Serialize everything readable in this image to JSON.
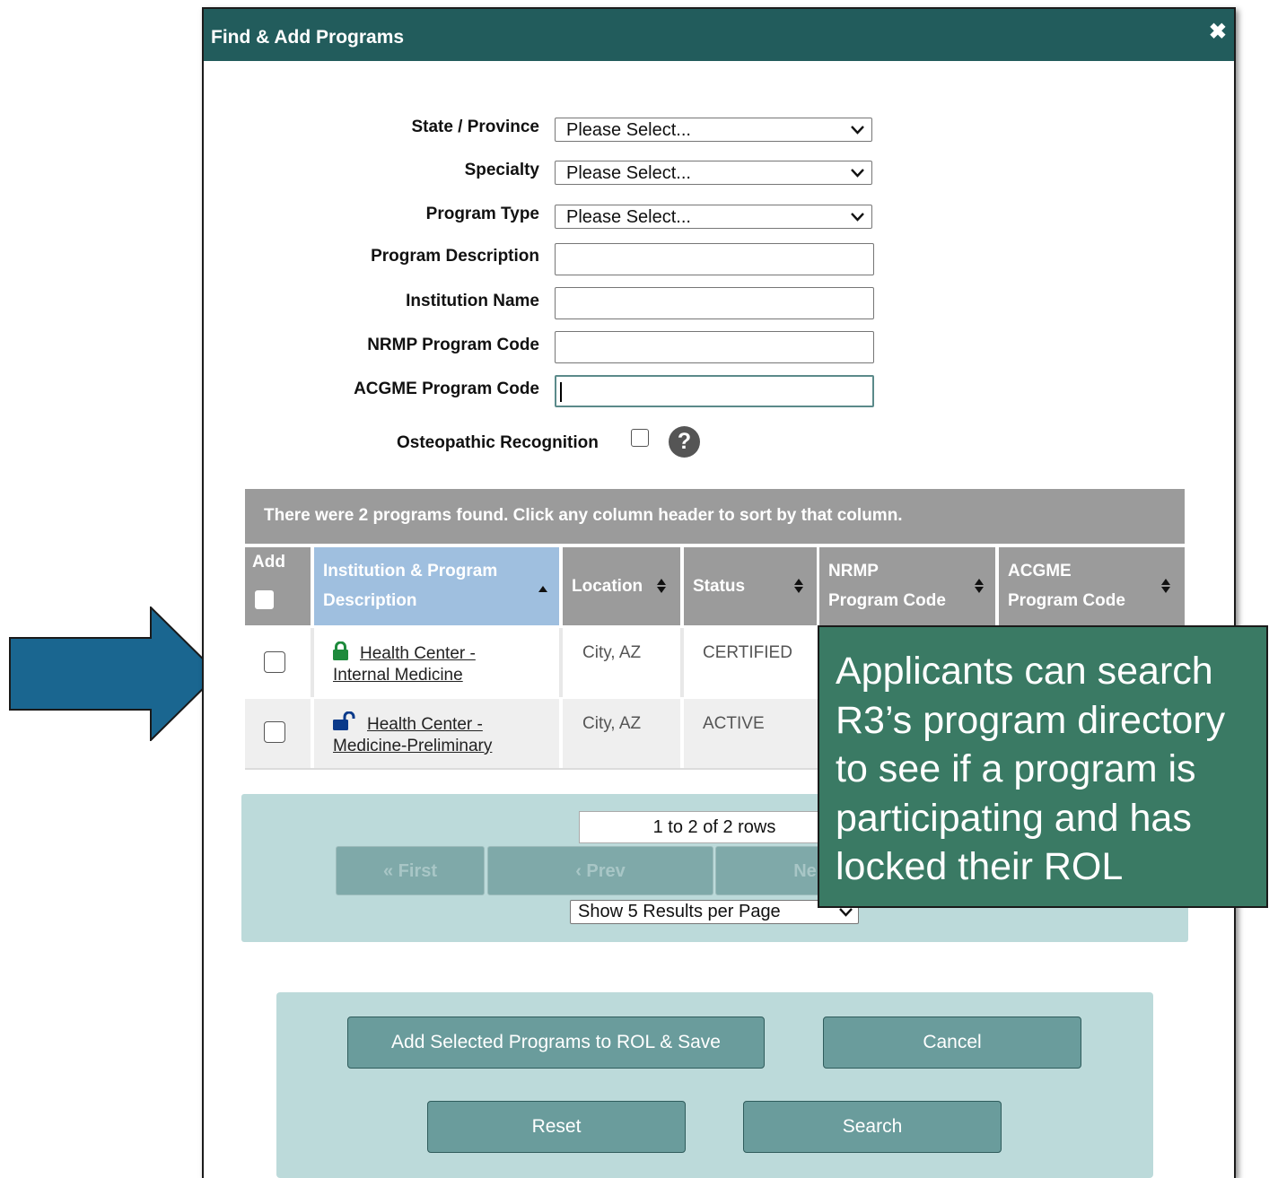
{
  "dialog": {
    "title": "Find & Add Programs",
    "close_glyph": "✖"
  },
  "form": {
    "state_label": "State / Province",
    "state_value": "Please Select...",
    "specialty_label": "Specialty",
    "specialty_value": "Please Select...",
    "program_type_label": "Program Type",
    "program_type_value": "Please Select...",
    "program_description_label": "Program Description",
    "program_description_value": "",
    "institution_name_label": "Institution Name",
    "institution_name_value": "",
    "nrmp_code_label": "NRMP Program Code",
    "nrmp_code_value": "",
    "acgme_code_label": "ACGME Program Code",
    "acgme_code_value": "",
    "osteopathic_label": "Osteopathic Recognition",
    "osteopathic_checked": false,
    "help_glyph": "?"
  },
  "results": {
    "summary": "There were 2 programs found. Click any column header to sort by that column.",
    "headers": {
      "add": "Add",
      "institution_line1": "Institution & Program",
      "institution_line2": "Description",
      "location": "Location",
      "status": "Status",
      "nrmp_line1": "NRMP",
      "nrmp_line2": "Program Code",
      "acgme_line1": "ACGME",
      "acgme_line2": "Program Code"
    },
    "rows": [
      {
        "name_line1": "Health Center -",
        "name_line2": "Internal Medicine",
        "lock": "locked",
        "location": "City, AZ",
        "status": "CERTIFIED"
      },
      {
        "name_line1": "Health Center -",
        "name_line2": "Medicine-Preliminary",
        "lock": "unlocked",
        "location": "City, AZ",
        "status": "ACTIVE"
      }
    ]
  },
  "pager": {
    "rows_info": "1 to 2 of 2 rows",
    "first": "« First",
    "prev": "‹ Prev",
    "next": "Ne",
    "per_page": "Show 5 Results per Page"
  },
  "actions": {
    "add_selected": "Add Selected Programs to ROL & Save",
    "cancel": "Cancel",
    "reset": "Reset",
    "search": "Search"
  },
  "callout": {
    "lines": [
      "Applicants can search",
      "R3’s program directory",
      "to see if a program is",
      "participating and has",
      "locked their ROL"
    ]
  },
  "colors": {
    "title_bar": "#225c5c",
    "table_header": "#9b9b9b",
    "sorted_header": "#9fbfdf",
    "panel": "#bcdada",
    "button": "#6a9c9c",
    "callout": "#3a7a64",
    "arrow": "#1a6690",
    "locked_icon": "#1e8a3c",
    "unlocked_icon": "#0a3a8a"
  },
  "icons": [
    "close-icon",
    "chevron-down-icon",
    "help-icon",
    "sort-icon",
    "lock-icon",
    "unlock-icon",
    "arrow-right-icon"
  ]
}
